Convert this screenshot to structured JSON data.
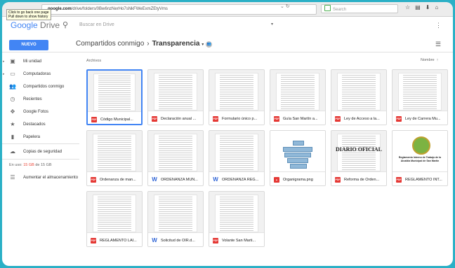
{
  "browser": {
    "tooltip_lines": [
      "Click to go back one page",
      "Pull down to show history"
    ],
    "url_host": "google.com",
    "url_path": "/drive/folders/0Bw6nzNerHo7sNkFWeExmZEtyVms",
    "url_prefix": "https://drive.",
    "search_placeholder": "Search"
  },
  "header": {
    "logo_google": "Google",
    "logo_drive": "Drive",
    "search_placeholder": "Buscar en Drive"
  },
  "toolbar": {
    "new_label": "NUEVO",
    "breadcrumb_parent": "Compartidos conmigo",
    "breadcrumb_current": "Transparencia"
  },
  "sidebar": {
    "items": [
      {
        "label": "Mi unidad",
        "icon": "drive-icon"
      },
      {
        "label": "Computadoras",
        "icon": "computer-icon"
      },
      {
        "label": "Compartidos conmigo",
        "icon": "people-icon"
      },
      {
        "label": "Recientes",
        "icon": "clock-icon"
      },
      {
        "label": "Google Fotos",
        "icon": "pinwheel-icon"
      },
      {
        "label": "Destacados",
        "icon": "star-icon"
      },
      {
        "label": "Papelera",
        "icon": "trash-icon"
      }
    ],
    "backups": "Copias de seguridad",
    "storage_used": "15 GB",
    "storage_text": "En uso: 15 GB de 15 GB",
    "storage_prefix": "En uso:",
    "storage_suffix": "de 15 GB",
    "upgrade": "Aumentar el almacenamiento"
  },
  "main": {
    "section_label": "Archivos",
    "sort_label": "Nombre"
  },
  "files": [
    {
      "name": "Código Municipal...",
      "type": "pdf"
    },
    {
      "name": "Declaración anual ...",
      "type": "pdf"
    },
    {
      "name": "Formulario único p...",
      "type": "pdf"
    },
    {
      "name": "Guía San Martín a...",
      "type": "pdf"
    },
    {
      "name": "Ley de Acceso a la...",
      "type": "pdf"
    },
    {
      "name": "Ley de Carrera Mu...",
      "type": "pdf"
    },
    {
      "name": "Ordenanza de man...",
      "type": "pdf"
    },
    {
      "name": "ORDENANZA MUN...",
      "type": "doc"
    },
    {
      "name": "ORDENANZA REG...",
      "type": "doc"
    },
    {
      "name": "Organigrama.png",
      "type": "img"
    },
    {
      "name": "Reforma de Orden...",
      "type": "pdf"
    },
    {
      "name": "REGLAMENTO INT...",
      "type": "pdf"
    },
    {
      "name": "REGLAMENTO LAI...",
      "type": "pdf"
    },
    {
      "name": "Solicitud de OIR.d...",
      "type": "doc"
    },
    {
      "name": "Volante San Marti...",
      "type": "pdf"
    }
  ],
  "thumb_text": {
    "diario": "DIARIO OFICIAL",
    "reglamento": "Reglamento Interno de Trabajo de la Alcaldía Municipal de San Martín"
  },
  "colors": {
    "accent": "#4285f4",
    "pdf": "#e53935",
    "frame": "#2bb0c6"
  }
}
